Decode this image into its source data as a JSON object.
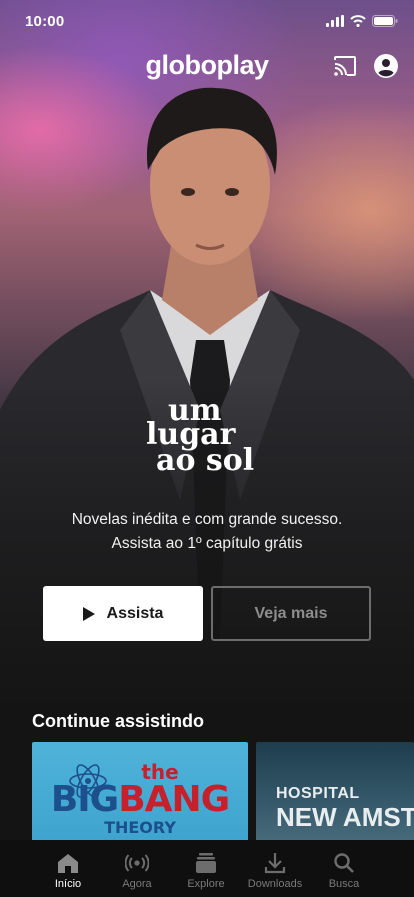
{
  "status_bar": {
    "time": "10:00"
  },
  "header": {
    "logo": "globoplay",
    "cast_icon": "cast-icon",
    "profile_icon": "profile-icon"
  },
  "hero": {
    "show_title_lines": [
      "um",
      "lugar",
      "ao sol"
    ],
    "description_line1": "Novelas inédita e com grande sucesso.",
    "description_line2": "Assista ao 1º capítulo grátis",
    "primary_button": "Assista",
    "secondary_button": "Veja mais"
  },
  "continue_watching": {
    "title": "Continue assistindo",
    "items": [
      {
        "logo_lines": [
          "the",
          "BIG",
          "BANG",
          "THEORY"
        ]
      },
      {
        "logo_lines": [
          "HOSPITAL",
          "NEW AMSTERDAM"
        ]
      }
    ]
  },
  "bottom_nav": [
    {
      "label": "Início",
      "icon": "home-icon",
      "active": true
    },
    {
      "label": "Agora",
      "icon": "broadcast-icon",
      "active": false
    },
    {
      "label": "Explore",
      "icon": "stack-icon",
      "active": false
    },
    {
      "label": "Downloads",
      "icon": "download-icon",
      "active": false
    },
    {
      "label": "Busca",
      "icon": "search-icon",
      "active": false
    }
  ],
  "colors": {
    "background": "#141414",
    "nav_background": "#0f0f0f",
    "bbt_red": "#c6202d",
    "bbt_blue": "#1d4f8c"
  }
}
